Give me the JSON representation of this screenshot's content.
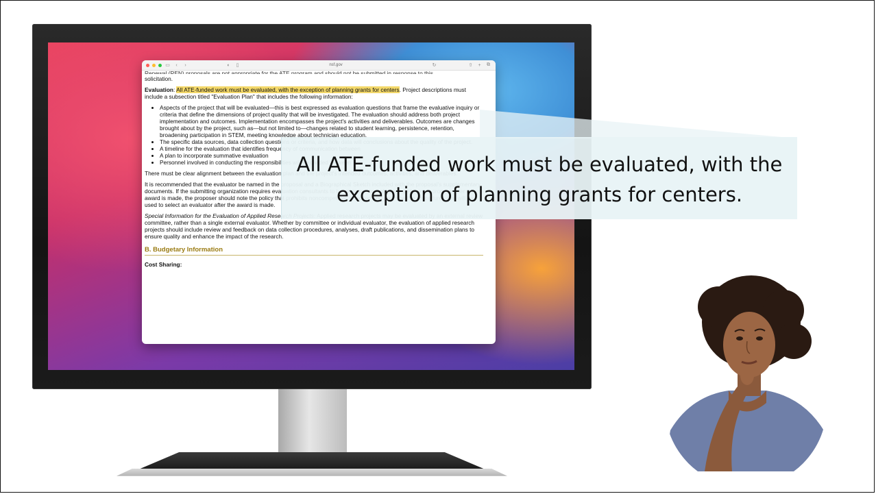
{
  "browser": {
    "url": "nsf.gov",
    "colors": {
      "close": "#ff5f57",
      "minimize": "#febc2e",
      "zoom": "#28c840"
    }
  },
  "document": {
    "cut_line": "Renewal (REN) proposals are not appropriate for the ATE program and should not be submitted in response to this",
    "solicitation": "solicitation.",
    "evaluation_label": "Evaluation",
    "evaluation_highlight": "All ATE-funded work must be evaluated, with the exception of planning grants for centers",
    "evaluation_rest": ". Project descriptions must include a subsection titled \"Evaluation Plan\" that includes the following information:",
    "bullets": [
      "Aspects of the project that will be evaluated—this is best expressed as evaluation questions that frame the evaluative inquiry or criteria that define the dimensions of project quality that will be investigated. The evaluation should address both project implementation and outcomes. Implementation encompasses the project's activities and deliverables. Outcomes are changes brought about by the project, such as—but not limited to—changes related to student learning, persistence, retention, broadening participation in STEM, meeting knowledge about technician education.",
      "The specific data sources, data collection questions or criteria, and how data will conclusions about the quality of the project.",
      "A timeline for the evaluation that identifies frequency of communication between",
      "A plan to incorporate summative evaluation",
      "Personnel involved in conducting the responsibilities will be divided between"
    ],
    "alignment": "There must be clear alignment between the evaluation plan and the project's intended outcomes, activities, and deliverables.",
    "recommended": "It is recommended that the evaluator be named in the proposal and a Biographical Sketch included with the proposal's supplementary documents. If the submitting organization requires evaluation consultants to be selected through a competitive bid process after an award is made, the proposer should note the policy that prohibits noncompetitive selection and describe the procedures that will be used to select an evaluator after the award is made.",
    "special_label": "Special Information for the Evaluation of Applied Research Projects",
    "special_text": ": Applied research projects may be evaluated by an external review committee, rather than a single external evaluator. Whether by committee or individual evaluator, the evaluation of applied research projects should include review and feedback on data collection procedures, analyses, draft publications, and dissemination plans to ensure quality and enhance the impact of the research.",
    "section_heading": "B. Budgetary Information",
    "cost_sharing": "Cost Sharing:"
  },
  "callout": {
    "line1": "All ATE-funded work must be evaluated, with the",
    "line2": "exception of planning grants for centers."
  },
  "illustration": "thinking-woman"
}
